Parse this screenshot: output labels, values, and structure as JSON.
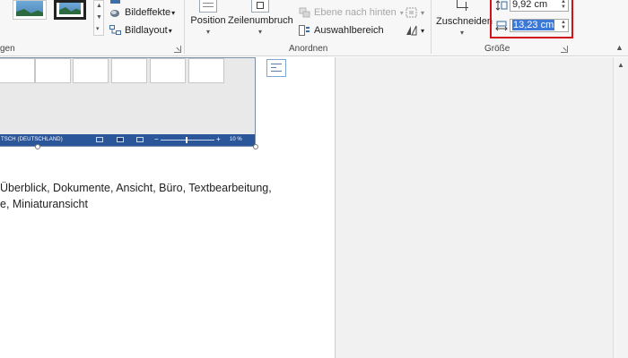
{
  "ribbon": {
    "picture_effects": "Bildeffekte",
    "picture_layout": "Bildlayout",
    "group_styles_partial": "gen",
    "arrange": {
      "group_label": "Anordnen",
      "position": "Position",
      "wrap_text": "Zeilenumbruch",
      "send_backward": "Ebene nach hinten",
      "selection_pane": "Auswahlbereich"
    },
    "size": {
      "group_label": "Größe",
      "crop": "Zuschneiden",
      "height_value": "9,92  cm",
      "width_value": "13,23  cm"
    }
  },
  "embedded_screenshot": {
    "status_language": "TSCH (DEUTSCHLAND)",
    "zoom_percent": "10 %"
  },
  "document": {
    "line1": " Überblick, Dokumente, Ansicht, Büro, Textbearbeitung,",
    "line2": "e, Miniaturansicht"
  },
  "colors": {
    "highlight_border": "#d0121b",
    "status_bar": "#2b579a",
    "selection": "#3b78d8"
  }
}
